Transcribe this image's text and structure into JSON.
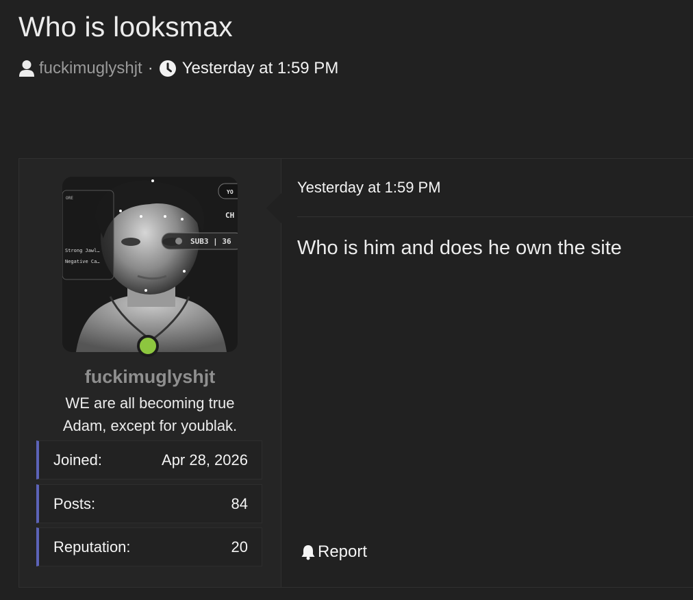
{
  "thread": {
    "title": "Who is looksmax",
    "author": "fuckimuglyshjt",
    "separator": "·",
    "date": "Yesterday at 1:59 PM"
  },
  "post": {
    "user": {
      "username": "fuckimuglyshjt",
      "title": "WE are all becoming true Adam, except for youblak.",
      "online": true,
      "online_color": "#8dc63f",
      "avatar_text": {
        "panel_label": "ORE",
        "line1": "Strong Jawl…",
        "line2": "Negative Ca…",
        "pill": "SUB3 | 36",
        "corner_top": "YO",
        "corner_mid": "CH"
      },
      "stats": [
        {
          "label": "Joined:",
          "value": "Apr 28, 2026"
        },
        {
          "label": "Posts:",
          "value": "84"
        },
        {
          "label": "Reputation:",
          "value": "20"
        }
      ],
      "stat_accent_color": "#5c63b8"
    },
    "date": "Yesterday at 1:59 PM",
    "message": "Who is him and does he own the site",
    "actions": {
      "report_label": "Report"
    }
  },
  "icons": {
    "author": "user-icon",
    "date": "clock-icon",
    "report": "bell-icon"
  }
}
